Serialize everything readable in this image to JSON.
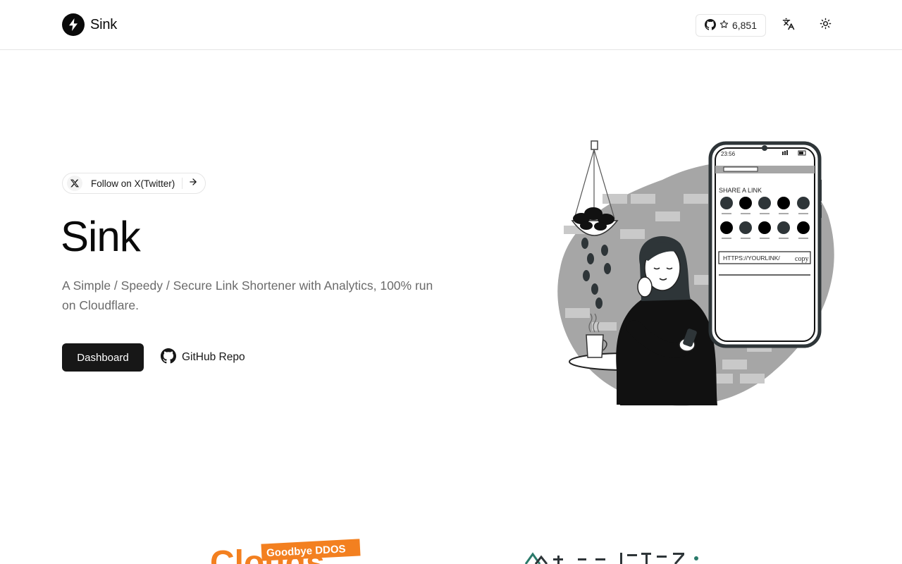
{
  "header": {
    "brand": "Sink",
    "github_stars": "6,851"
  },
  "hero": {
    "badge_text": "Follow on X(Twitter)",
    "title": "Sink",
    "description": "A Simple / Speedy / Secure Link Shortener with Analytics, 100% run on Cloudflare.",
    "primary_button": "Dashboard",
    "secondary_button": "GitHub Repo"
  },
  "illustration": {
    "phone_time": "23:56",
    "share_label": "SHARE A LINK",
    "link_placeholder": "HTTPS://YOURLINK/",
    "copy_label": "copy"
  },
  "partners": {
    "partner1_tagline": "Goodbye DDOS"
  }
}
